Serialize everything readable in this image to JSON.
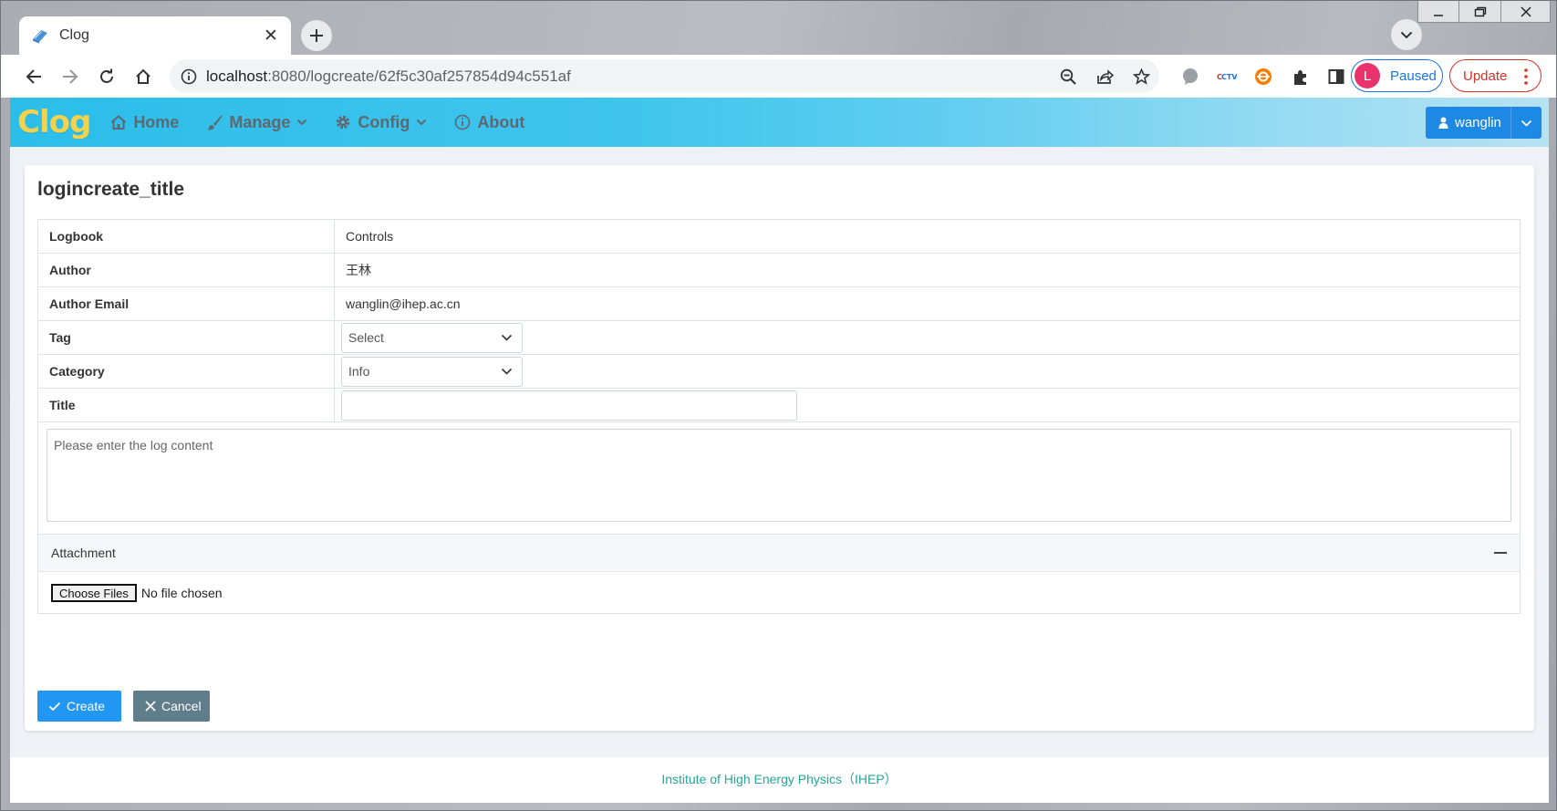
{
  "browser": {
    "tab_title": "Clog",
    "url_host": "localhost",
    "url_path": ":8080/logcreate/62f5c30af257854d94c551af",
    "profile_initial": "L",
    "profile_status": "Paused",
    "update_label": "Update",
    "colors": {
      "profile": "#1a73e8",
      "update": "#d93025",
      "avatar": "#e8336d"
    }
  },
  "app": {
    "brand": "Clog",
    "nav": [
      {
        "label": "Home",
        "icon": "home-icon"
      },
      {
        "label": "Manage",
        "icon": "brush-icon",
        "dropdown": true
      },
      {
        "label": "Config",
        "icon": "gear-icon",
        "dropdown": true
      },
      {
        "label": "About",
        "icon": "info-icon"
      }
    ],
    "user": "wanglin",
    "colors": {
      "brand": "#f3d24d",
      "primary": "#1e88e5"
    }
  },
  "form": {
    "title": "logincreate_title",
    "rows": {
      "logbook": {
        "label": "Logbook",
        "value": "Controls"
      },
      "author": {
        "label": "Author",
        "value": "王林"
      },
      "email": {
        "label": "Author Email",
        "value": "wanglin@ihep.ac.cn"
      },
      "tag": {
        "label": "Tag",
        "value": "Select"
      },
      "category": {
        "label": "Category",
        "value": "Info"
      },
      "title": {
        "label": "Title",
        "value": ""
      }
    },
    "content_placeholder": "Please enter the log content",
    "attachment": {
      "header": "Attachment",
      "choose_label": "Choose Files",
      "status": "No file chosen"
    },
    "create_label": "Create",
    "cancel_label": "Cancel"
  },
  "footer": "Institute of High Energy Physics（IHEP）"
}
